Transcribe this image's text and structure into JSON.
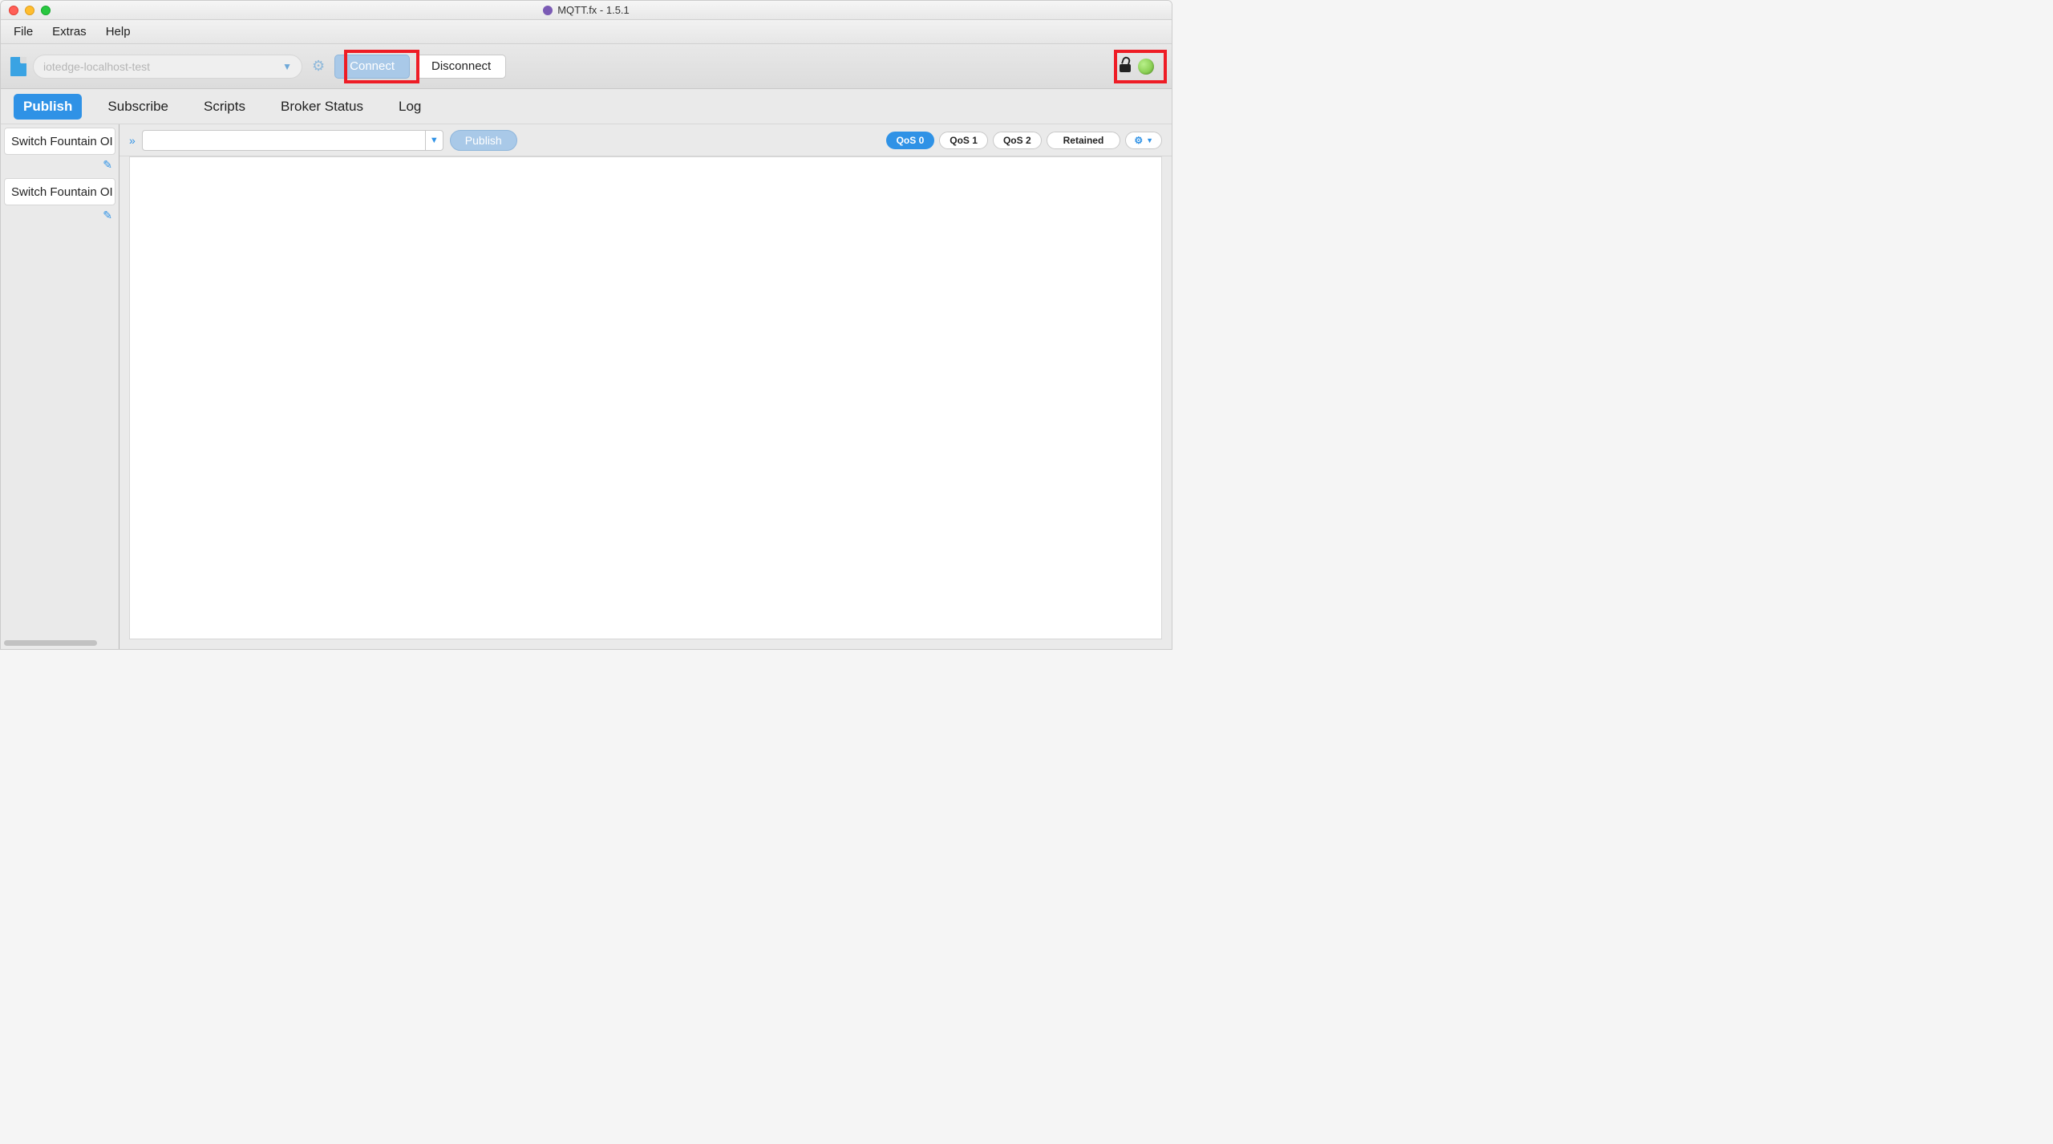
{
  "window": {
    "title": "MQTT.fx - 1.5.1"
  },
  "menubar": {
    "items": [
      "File",
      "Extras",
      "Help"
    ]
  },
  "connection": {
    "profile_placeholder": "iotedge-localhost-test",
    "connect_label": "Connect",
    "disconnect_label": "Disconnect"
  },
  "tabs": {
    "items": [
      "Publish",
      "Subscribe",
      "Scripts",
      "Broker Status",
      "Log"
    ],
    "active": "Publish"
  },
  "sidebar": {
    "items": [
      {
        "label": "Switch Fountain OI"
      },
      {
        "label": "Switch Fountain OI"
      }
    ]
  },
  "publish": {
    "publish_label": "Publish",
    "qos": [
      "QoS 0",
      "QoS 1",
      "QoS 2"
    ],
    "qos_active": "QoS 0",
    "retained_label": "Retained"
  }
}
